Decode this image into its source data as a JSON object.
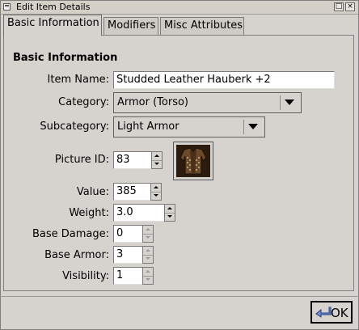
{
  "window": {
    "title": "Edit Item Details",
    "maximize_glyph": "□",
    "close_glyph": "×"
  },
  "tabs": [
    {
      "label": "Basic Information"
    },
    {
      "label": "Modifiers"
    },
    {
      "label": "Misc Attributes"
    }
  ],
  "form": {
    "section_title": "Basic Information",
    "item_name": {
      "label": "Item Name:",
      "value": "Studded Leather Hauberk +2"
    },
    "category": {
      "label": "Category:",
      "value": "Armor (Torso)"
    },
    "subcategory": {
      "label": "Subcategory:",
      "value": "Light Armor"
    },
    "picture_id": {
      "label": "Picture ID:",
      "value": "83",
      "icon": "leather-armor-picture"
    },
    "value": {
      "label": "Value:",
      "value": "385"
    },
    "weight": {
      "label": "Weight:",
      "value": "3.0"
    },
    "base_damage": {
      "label": "Base Damage:",
      "value": "0"
    },
    "base_armor": {
      "label": "Base Armor:",
      "value": "3"
    },
    "visibility": {
      "label": "Visibility:",
      "value": "1"
    }
  },
  "footer": {
    "ok_label": "OK",
    "ok_icon": "return-arrow-icon"
  },
  "colors": {
    "background": "#d6d3ce",
    "text": "#000000"
  }
}
